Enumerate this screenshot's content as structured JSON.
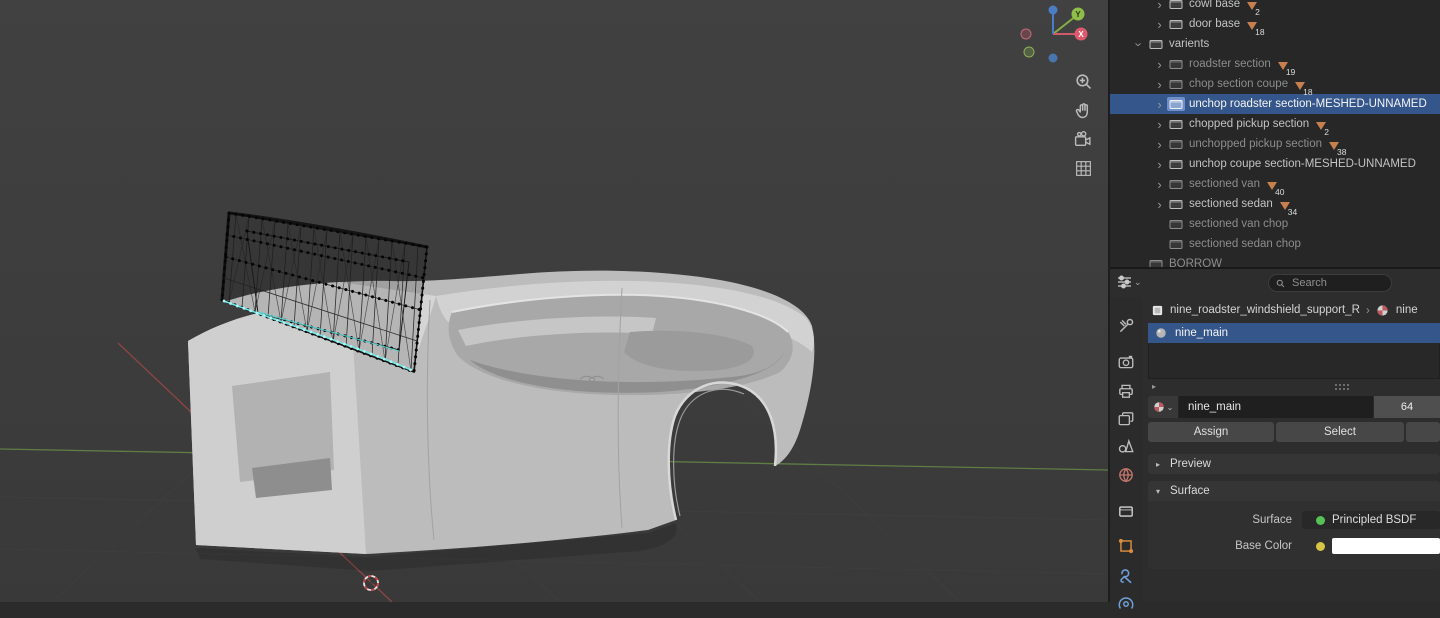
{
  "viewport": {
    "gizmo": {
      "x": "X",
      "y": "Y"
    },
    "colors": {
      "background": "#3d3d3d",
      "axis_x": "#8f4545",
      "axis_y": "#5f7d45",
      "gizmo_x": "#dd5a6c",
      "gizmo_y": "#8fbe49",
      "gizmo_z": "#4a7ec4",
      "selected_edge_cyan": "#6fe8e6"
    }
  },
  "outliner": {
    "selection_color": "#35568a",
    "badge_color": "#c87f4e",
    "items": [
      {
        "label": "cowl base",
        "badge": "2"
      },
      {
        "label": "door base",
        "badge": "18"
      },
      {
        "label": "varients",
        "badge": ""
      },
      {
        "label": "roadster section",
        "badge": "19"
      },
      {
        "label": "chop section coupe",
        "badge": "18"
      },
      {
        "label": "unchop roadster section-MESHED-UNNAMED",
        "badge": ""
      },
      {
        "label": "chopped pickup section",
        "badge": "2"
      },
      {
        "label": "unchopped pickup section",
        "badge": "38"
      },
      {
        "label": "unchop coupe section-MESHED-UNNAMED",
        "badge": ""
      },
      {
        "label": "sectioned van",
        "badge": "40"
      },
      {
        "label": "sectioned sedan",
        "badge": "34"
      },
      {
        "label": "sectioned van chop",
        "badge": ""
      },
      {
        "label": "sectioned sedan chop",
        "badge": ""
      },
      {
        "label": "BORROW",
        "badge": ""
      }
    ]
  },
  "properties": {
    "search_placeholder": "Search",
    "breadcrumb": {
      "object": "nine_roadster_windshield_support_R",
      "material": "nine"
    },
    "slots": {
      "active": "nine_main"
    },
    "datablock": {
      "name": "nine_main",
      "users": "64"
    },
    "buttons": {
      "assign": "Assign",
      "select": "Select"
    },
    "panels": {
      "preview": "Preview",
      "surface": "Surface"
    },
    "surface": {
      "label": "Surface",
      "shader": "Principled BSDF",
      "base_color_label": "Base Color",
      "base_color_hex": "#FFFFFF"
    }
  }
}
